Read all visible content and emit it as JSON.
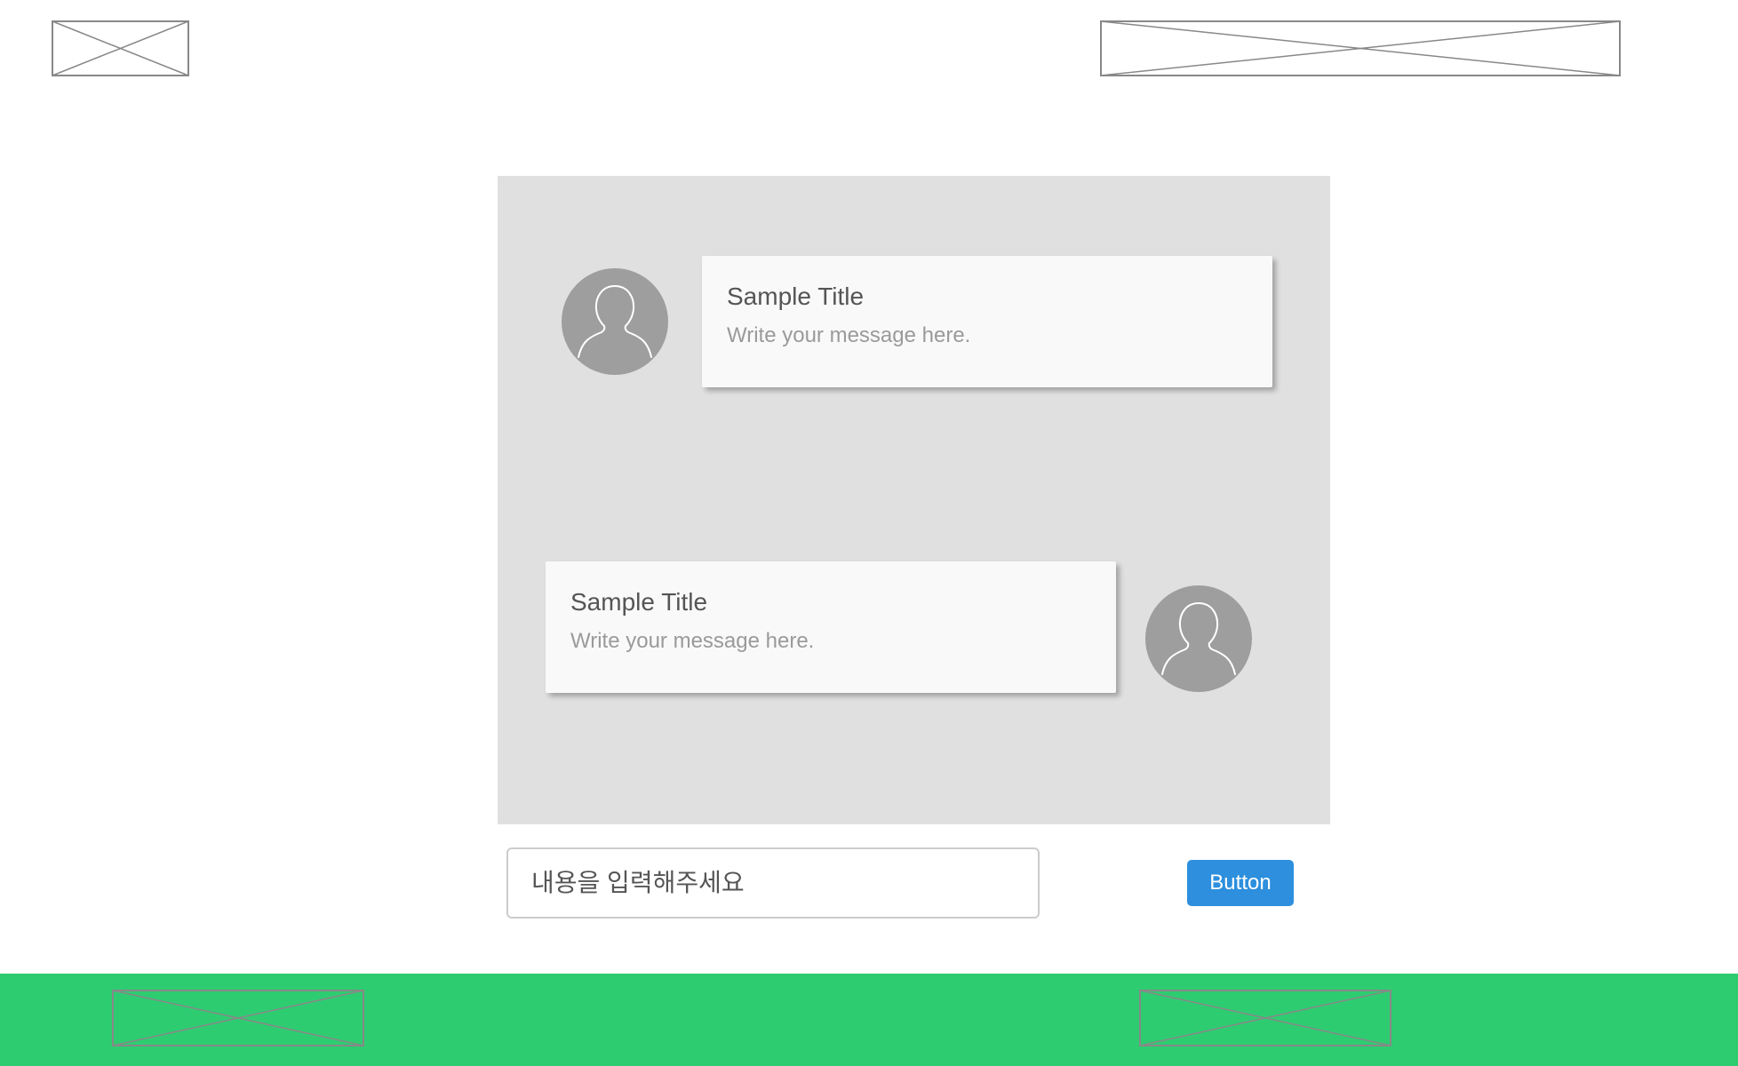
{
  "header": {
    "logo_placeholder_icon": "image-placeholder-icon",
    "banner_placeholder_icon": "image-placeholder-icon"
  },
  "chat": {
    "messages": [
      {
        "title": "Sample Title",
        "text": "Write your message here.",
        "avatar_icon": "user-avatar-icon",
        "side": "left"
      },
      {
        "title": "Sample Title",
        "text": "Write your message here.",
        "avatar_icon": "user-avatar-icon",
        "side": "right"
      }
    ]
  },
  "composer": {
    "input_placeholder": "내용을 입력해주세요",
    "button_label": "Button"
  },
  "footer": {
    "placeholder_icons": [
      "image-placeholder-icon",
      "image-placeholder-icon"
    ]
  },
  "colors": {
    "chat_background": "#e0e0e0",
    "bubble_background": "#f9f9f9",
    "avatar": "#9e9e9e",
    "button": "#2d8fdd",
    "footer": "#2ecc71",
    "placeholder_stroke": "#888888"
  }
}
